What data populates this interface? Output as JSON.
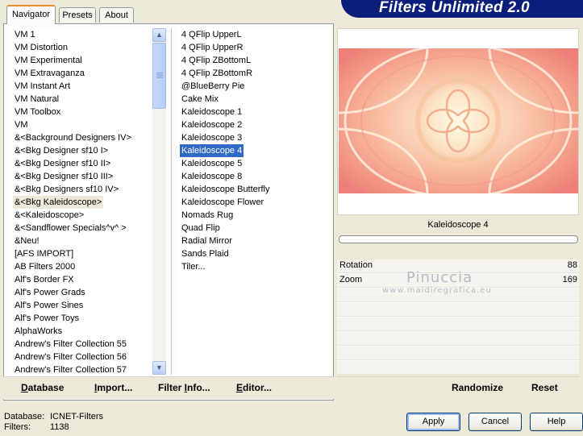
{
  "app": {
    "title": "Filters Unlimited 2.0"
  },
  "tabs": [
    {
      "label": "Navigator",
      "active": true
    },
    {
      "label": "Presets",
      "active": false
    },
    {
      "label": "About",
      "active": false
    }
  ],
  "categories": [
    "VM 1",
    "VM Distortion",
    "VM Experimental",
    "VM Extravaganza",
    "VM Instant Art",
    "VM Natural",
    "VM Toolbox",
    "VM",
    "&<Background Designers IV>",
    "&<Bkg Designer sf10 I>",
    "&<Bkg Designer sf10 II>",
    "&<Bkg Designer sf10 III>",
    "&<Bkg Designers sf10 IV>",
    "&<Bkg Kaleidoscope>",
    "&<Kaleidoscope>",
    "&<Sandflower Specials^v^ >",
    "&Neu!",
    "[AFS IMPORT]",
    "AB Filters 2000",
    "Alf's Border FX",
    "Alf's Power Grads",
    "Alf's Power Sines",
    "Alf's Power Toys",
    "AlphaWorks",
    "Andrew's Filter Collection 55",
    "Andrew's Filter Collection 56",
    "Andrew's Filter Collection 57"
  ],
  "selected_category_index": 13,
  "filters": [
    "4 QFlip UpperL",
    "4 QFlip UpperR",
    "4 QFlip ZBottomL",
    "4 QFlip ZBottomR",
    "@BlueBerry Pie",
    "Cake Mix",
    "Kaleidoscope 1",
    "Kaleidoscope 2",
    "Kaleidoscope 3",
    "Kaleidoscope 4",
    "Kaleidoscope 5",
    "Kaleidoscope 8",
    "Kaleidoscope Butterfly",
    "Kaleidoscope Flower",
    "Nomads Rug",
    "Quad Flip",
    "Radial Mirror",
    "Sands Plaid",
    "Tiler..."
  ],
  "selected_filter_index": 9,
  "preview": {
    "filter_name": "Kaleidoscope 4",
    "progress": 0
  },
  "params": [
    {
      "label": "Rotation",
      "value": "88"
    },
    {
      "label": "Zoom",
      "value": "169"
    }
  ],
  "watermark": {
    "line1": "Pinuccia",
    "line2": "www.maidiregrafica.eu"
  },
  "nav_buttons": {
    "database": {
      "u": "D",
      "rest": "atabase"
    },
    "import": {
      "u": "I",
      "rest": "mport..."
    },
    "filter_info": {
      "pre": "Filter ",
      "u": "I",
      "rest": "nfo..."
    },
    "editor": {
      "u": "E",
      "rest": "ditor..."
    }
  },
  "preview_buttons": {
    "randomize": "Randomize",
    "reset": "Reset"
  },
  "status": {
    "database_label": "Database:",
    "database_value": "ICNET-Filters",
    "filters_label": "Filters:",
    "filters_value": "1138"
  },
  "dialog_buttons": {
    "apply": "Apply",
    "cancel": "Cancel",
    "help": "Help"
  },
  "colors": {
    "banner": "#0a1e7a",
    "selection": "#316AC5",
    "tab_highlight": "#E68B2C"
  }
}
